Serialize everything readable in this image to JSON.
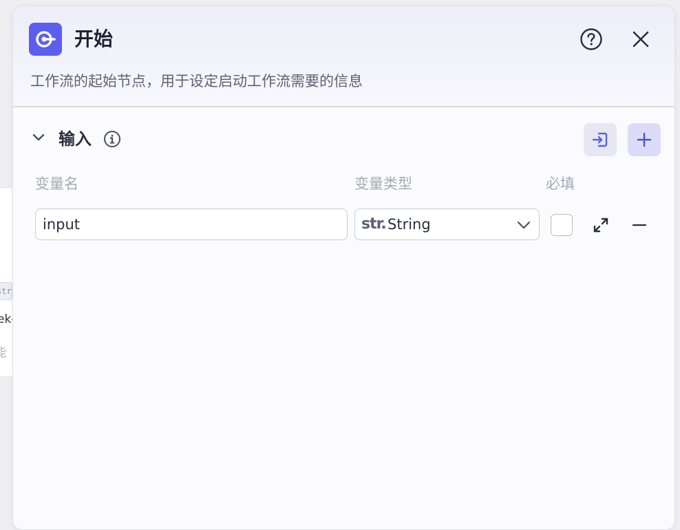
{
  "background": {
    "tag_text": "str]",
    "text_line_1": "ek-",
    "text_line_2": "能"
  },
  "panel": {
    "title": "开始",
    "description": "工作流的起始节点，用于设定启动工作流需要的信息",
    "icons": {
      "node": "start-node-icon",
      "help": "question-circle-icon",
      "close": "close-icon"
    }
  },
  "input_section": {
    "title": "输入",
    "icons": {
      "collapse": "chevron-down-icon",
      "info": "info-icon",
      "import": "import-icon",
      "add": "plus-icon"
    },
    "columns": {
      "name": "变量名",
      "type": "变量类型",
      "required": "必填"
    },
    "rows": [
      {
        "name": "input",
        "type_prefix": "str.",
        "type": "String",
        "required": false
      }
    ]
  },
  "colors": {
    "accent": "#5b5ff0",
    "add_button_bg": "#dcdcf8",
    "import_button_bg": "#e6e7f3",
    "title_text": "#1f2233",
    "muted_text": "#a7a9b7"
  }
}
